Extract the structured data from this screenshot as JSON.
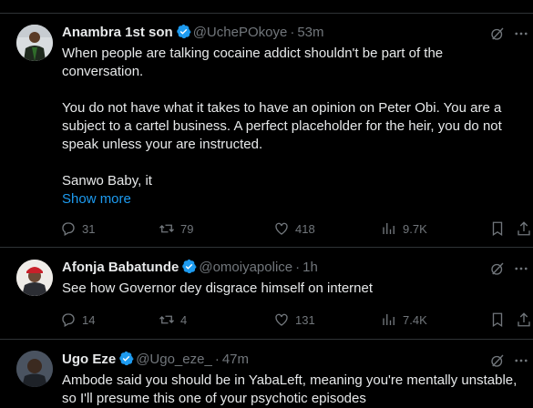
{
  "colors": {
    "background": "#000000",
    "text": "#e7e9ea",
    "muted": "#71767b",
    "link": "#1d9bf0",
    "verified": "#1d9bf0",
    "divider": "#2f3336"
  },
  "tweets": [
    {
      "author_name": "Anambra 1st son",
      "handle": "@UchePOkoye",
      "separator": "·",
      "time": "53m",
      "verified": true,
      "paragraphs": [
        "When people are talking cocaine addict shouldn't be part of the conversation.",
        "You do not have what it takes to have an opinion on Peter Obi. You are a subject to a cartel business. A perfect placeholder for the heir, you do not speak unless your are instructed.",
        "Sanwo Baby, it"
      ],
      "show_more": "Show more",
      "replies": "31",
      "reposts": "79",
      "likes": "418",
      "views": "9.7K",
      "icons": [
        "reply-icon",
        "repost-icon",
        "like-icon",
        "views-icon",
        "bookmark-icon",
        "share-icon",
        "grok-icon",
        "more-icon"
      ]
    },
    {
      "author_name": "Afonja Babatunde",
      "handle": "@omoiyapolice",
      "separator": "·",
      "time": "1h",
      "verified": true,
      "paragraphs": [
        "See how Governor dey disgrace himself on internet"
      ],
      "replies": "14",
      "reposts": "4",
      "likes": "131",
      "views": "7.4K"
    },
    {
      "author_name": "Ugo Eze",
      "handle": "@Ugo_eze_",
      "separator": "·",
      "time": "47m",
      "verified": true,
      "paragraphs": [
        "Ambode said you should be in YabaLeft, meaning you're mentally unstable, so I'll presume this one of your psychotic episodes"
      ]
    }
  ]
}
